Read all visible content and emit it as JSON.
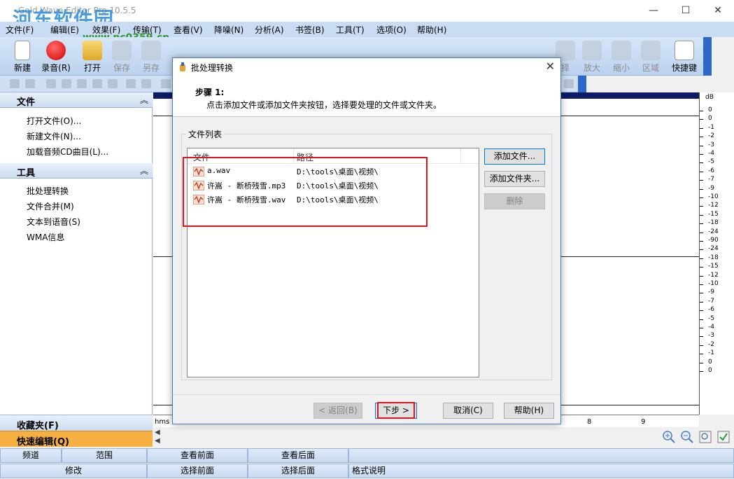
{
  "window": {
    "title": "Gold Wave Editor Pro 10.5.5",
    "watermark": "河东软件园",
    "watermark_url": "www.pc0359.cn",
    "minimize": "—",
    "maximize": "☐",
    "close": "✕"
  },
  "menu": [
    "文件(F)",
    "编辑(E)",
    "效果(F)",
    "传输(T)",
    "查看(V)",
    "降噪(N)",
    "分析(A)",
    "书签(B)",
    "工具(T)",
    "选项(O)",
    "帮助(H)"
  ],
  "toolbar": {
    "new": "新建",
    "record": "录音(R)",
    "open": "打开",
    "save": "保存",
    "save_as": "另存",
    "select_all": "择",
    "zoom_in": "放大",
    "zoom_out": "缩小",
    "region": "区域",
    "shortcuts": "快捷键"
  },
  "left_panel": {
    "file_section": {
      "title": "文件",
      "items": [
        "打开文件(O)...",
        "新建文件(N)...",
        "加载音频CD曲目(L)..."
      ]
    },
    "tools_section": {
      "title": "工具",
      "items": [
        "批处理转换",
        "文件合并(M)",
        "文本到语音(S)",
        "WMA信息"
      ]
    },
    "favorites": "收藏夹(F)",
    "quick_edit": "快速编辑(Q)"
  },
  "db_scale": [
    "dB",
    "0",
    "0",
    "-1",
    "-2",
    "-3",
    "-4",
    "-5",
    "-6",
    "-7",
    "-9",
    "-10",
    "-12",
    "-15",
    "-18",
    "-24",
    "-90",
    "-24",
    "-18",
    "-15",
    "-12",
    "-10",
    "-9",
    "-7",
    "-6",
    "-5",
    "-4",
    "-3",
    "-2",
    "-1",
    "0",
    "0"
  ],
  "timeline": {
    "unit": "hms",
    "mark8": "8",
    "mark9": "9"
  },
  "bottom_grid": {
    "row1": [
      "频道",
      "范围",
      "查看前面",
      "查看后面"
    ],
    "row2": [
      "修改",
      "选择前面",
      "选择后面",
      "格式说明"
    ]
  },
  "dialog": {
    "title": "批处理转换",
    "step": "步骤 1:",
    "description": "点击添加文件或添加文件夹按钮，选择要处理的文件或文件夹。",
    "group_label": "文件列表",
    "columns": {
      "file": "文件",
      "path": "路径"
    },
    "files": [
      {
        "name": "a.wav",
        "path": "D:\\tools\\桌面\\视频\\"
      },
      {
        "name": "许嵩 - 断桥残雪.mp3",
        "path": "D:\\tools\\桌面\\视频\\"
      },
      {
        "name": "许嵩 - 断桥残雪.wav",
        "path": "D:\\tools\\桌面\\视频\\"
      }
    ],
    "add_file": "添加文件...",
    "add_folder": "添加文件夹...",
    "delete": "删除",
    "back": "< 返回(B)",
    "next": "下步 >",
    "cancel": "取消(C)",
    "help": "帮助(H)"
  },
  "colors": {
    "highlight_red": "#e0141e",
    "toolbar_blue": "#2d67c8",
    "menu_bg": "#c9dcf3",
    "quick_edit_bg": "#f5b041"
  }
}
